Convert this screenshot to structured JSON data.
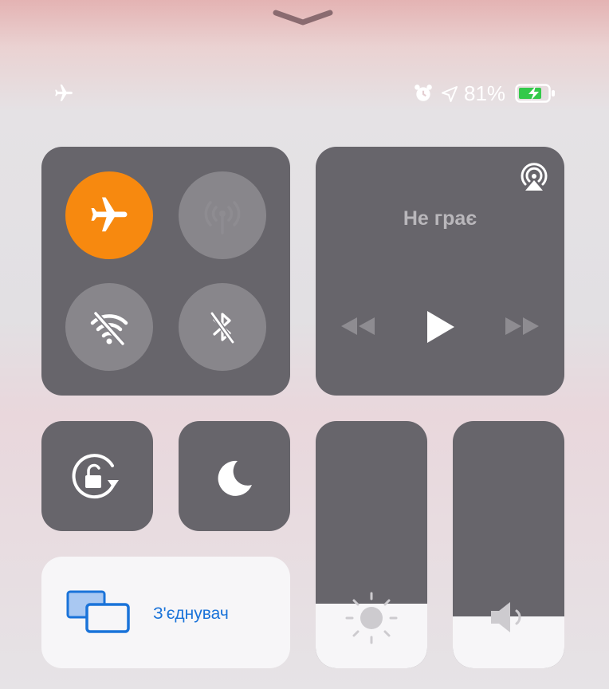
{
  "status_bar": {
    "battery_text": "81%",
    "icons": [
      "airplane-icon",
      "alarm-icon",
      "location-icon",
      "battery-charging-icon"
    ]
  },
  "connectivity": {
    "airplane_mode": true,
    "cellular": false,
    "wifi": false,
    "bluetooth": false
  },
  "media": {
    "title": "Не грає",
    "icons": [
      "airplay-icon",
      "rewind-icon",
      "play-icon",
      "fast-forward-icon"
    ]
  },
  "controls": {
    "icons": [
      "rotation-lock-icon",
      "moon-icon"
    ]
  },
  "screen_mirroring": {
    "label": "З'єднувач",
    "icon": "screen-mirroring-icon"
  },
  "brightness": {
    "level": 0.26,
    "icon": "sun-icon"
  },
  "volume": {
    "level": 0.21,
    "icon": "speaker-icon"
  },
  "colors": {
    "accent_orange": "#f7890f",
    "tile_bg": "#67656b",
    "link_blue": "#1a73d9"
  }
}
